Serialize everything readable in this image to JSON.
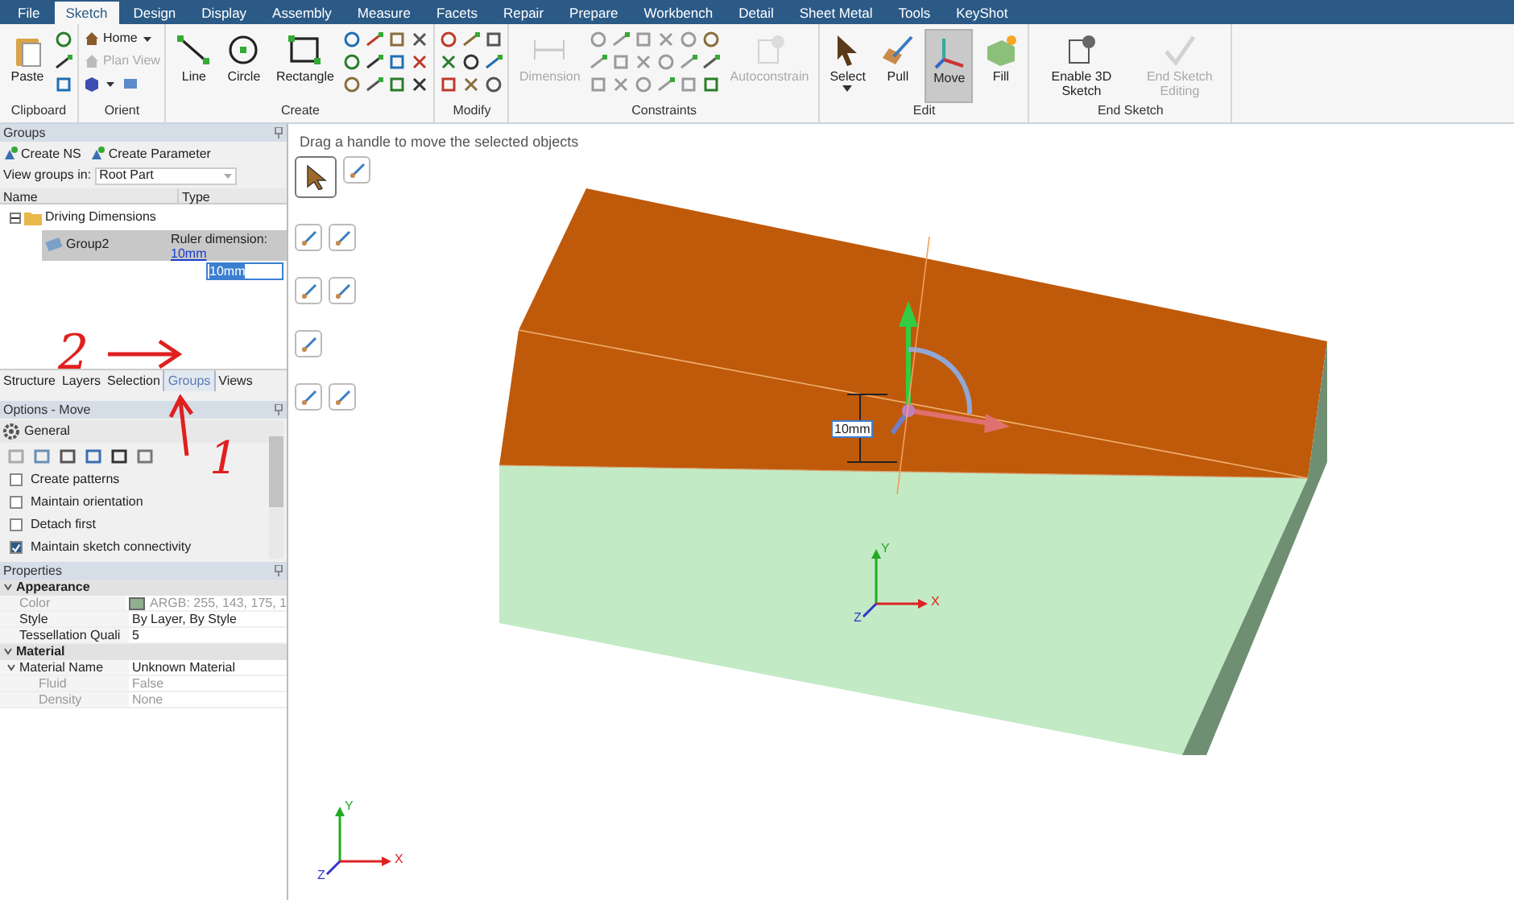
{
  "menu_tabs": [
    {
      "label": "File",
      "selected": false
    },
    {
      "label": "Sketch",
      "selected": true
    },
    {
      "label": "Design",
      "selected": false
    },
    {
      "label": "Display",
      "selected": false
    },
    {
      "label": "Assembly",
      "selected": false
    },
    {
      "label": "Measure",
      "selected": false
    },
    {
      "label": "Facets",
      "selected": false
    },
    {
      "label": "Repair",
      "selected": false
    },
    {
      "label": "Prepare",
      "selected": false
    },
    {
      "label": "Workbench",
      "selected": false
    },
    {
      "label": "Detail",
      "selected": false
    },
    {
      "label": "Sheet Metal",
      "selected": false
    },
    {
      "label": "Tools",
      "selected": false
    },
    {
      "label": "KeyShot",
      "selected": false
    }
  ],
  "ribbon_groups": [
    {
      "title": "Clipboard",
      "items": [
        {
          "kind": "large",
          "label": "Paste",
          "disabled": false,
          "selected": false
        },
        {
          "kind": "grid",
          "disabled": false
        }
      ]
    },
    {
      "title": "Orient",
      "items": [
        {
          "kind": "rows",
          "rows": [
            {
              "label": "Home",
              "dropdown": true,
              "disabled": false
            },
            {
              "label": "Plan View",
              "dropdown": false,
              "disabled": true
            },
            {
              "dropdown": true,
              "disabled": false
            }
          ]
        }
      ]
    },
    {
      "title": "Create",
      "items": [
        {
          "kind": "large",
          "label": "Line",
          "disabled": false,
          "selected": false
        },
        {
          "kind": "large",
          "label": "Circle",
          "disabled": false,
          "selected": false
        },
        {
          "kind": "large",
          "label": "Rectangle",
          "disabled": false,
          "selected": false
        },
        {
          "kind": "grid",
          "disabled": false
        }
      ]
    },
    {
      "title": "Modify",
      "items": [
        {
          "kind": "grid",
          "disabled": false
        }
      ]
    },
    {
      "title": "Constraints",
      "items": [
        {
          "kind": "large",
          "label": "Dimension",
          "disabled": true,
          "selected": false
        },
        {
          "kind": "grid",
          "disabled": true
        },
        {
          "kind": "grid",
          "disabled": false
        },
        {
          "kind": "large",
          "label": "Autoconstrain",
          "disabled": true,
          "selected": false
        }
      ]
    },
    {
      "title": "Edit",
      "items": [
        {
          "kind": "large",
          "label": "Select",
          "dropdown": true,
          "disabled": false,
          "selected": false
        },
        {
          "kind": "large",
          "label": "Pull",
          "disabled": false,
          "selected": false
        },
        {
          "kind": "large",
          "label": "Move",
          "disabled": false,
          "selected": true
        },
        {
          "kind": "large",
          "label": "Fill",
          "disabled": false,
          "selected": false
        }
      ]
    },
    {
      "title": "End Sketch",
      "items": [
        {
          "kind": "large",
          "label": "Enable 3D Sketch",
          "disabled": false,
          "selected": false
        },
        {
          "kind": "large",
          "label": "End Sketch Editing",
          "disabled": true,
          "selected": false
        }
      ]
    }
  ],
  "groups_panel": {
    "title": "Groups",
    "toolbar": [
      "Create NS",
      "Create Parameter"
    ],
    "view_label": "View groups in:",
    "view_value": "Root Part",
    "columns": [
      "Name",
      "Type"
    ],
    "tree": [
      {
        "name": "Driving Dimensions",
        "expanded": true,
        "selected": false,
        "children": [
          {
            "name": "Group2",
            "type": "Ruler dimension:",
            "type_link": "10mm",
            "selected": true
          }
        ]
      }
    ],
    "edit_value": "10mm"
  },
  "panel_tabs": [
    {
      "label": "Structure",
      "selected": false
    },
    {
      "label": "Layers",
      "selected": false
    },
    {
      "label": "Selection",
      "selected": false
    },
    {
      "label": "Groups",
      "selected": true
    },
    {
      "label": "Views",
      "selected": false
    }
  ],
  "options": {
    "title": "Options - Move",
    "section": "General",
    "checkboxes": [
      {
        "label": "Create patterns",
        "checked": false
      },
      {
        "label": "Maintain orientation",
        "checked": false
      },
      {
        "label": "Detach first",
        "checked": false
      },
      {
        "label": "Maintain sketch connectivity",
        "checked": true
      }
    ]
  },
  "properties": {
    "title": "Properties",
    "sections": [
      {
        "name": "Appearance",
        "rows": [
          {
            "name": "Color",
            "value": "ARGB: 255, 143, 175, 1",
            "color": "#8faf8f",
            "dim": true
          },
          {
            "name": "Style",
            "value": "By Layer, By Style",
            "dim": false
          },
          {
            "name": "Tessellation Quali",
            "value": "5",
            "dim": false
          }
        ]
      },
      {
        "name": "Material",
        "rows": [
          {
            "name": "Material Name",
            "value": "Unknown Material",
            "dim": false,
            "expandable": true
          },
          {
            "name": "Fluid",
            "value": "False",
            "dim": true,
            "indent": true
          },
          {
            "name": "Density",
            "value": "None",
            "dim": true,
            "indent": true
          }
        ]
      }
    ]
  },
  "canvas": {
    "hint": "Drag a handle to move the selected objects",
    "dimension_label": "10mm",
    "model_triad": [
      "Y",
      "X",
      "Z"
    ],
    "view_triad": [
      "Y",
      "X",
      "Z"
    ]
  },
  "annotations": [
    {
      "label": "2"
    },
    {
      "label": "1"
    }
  ]
}
